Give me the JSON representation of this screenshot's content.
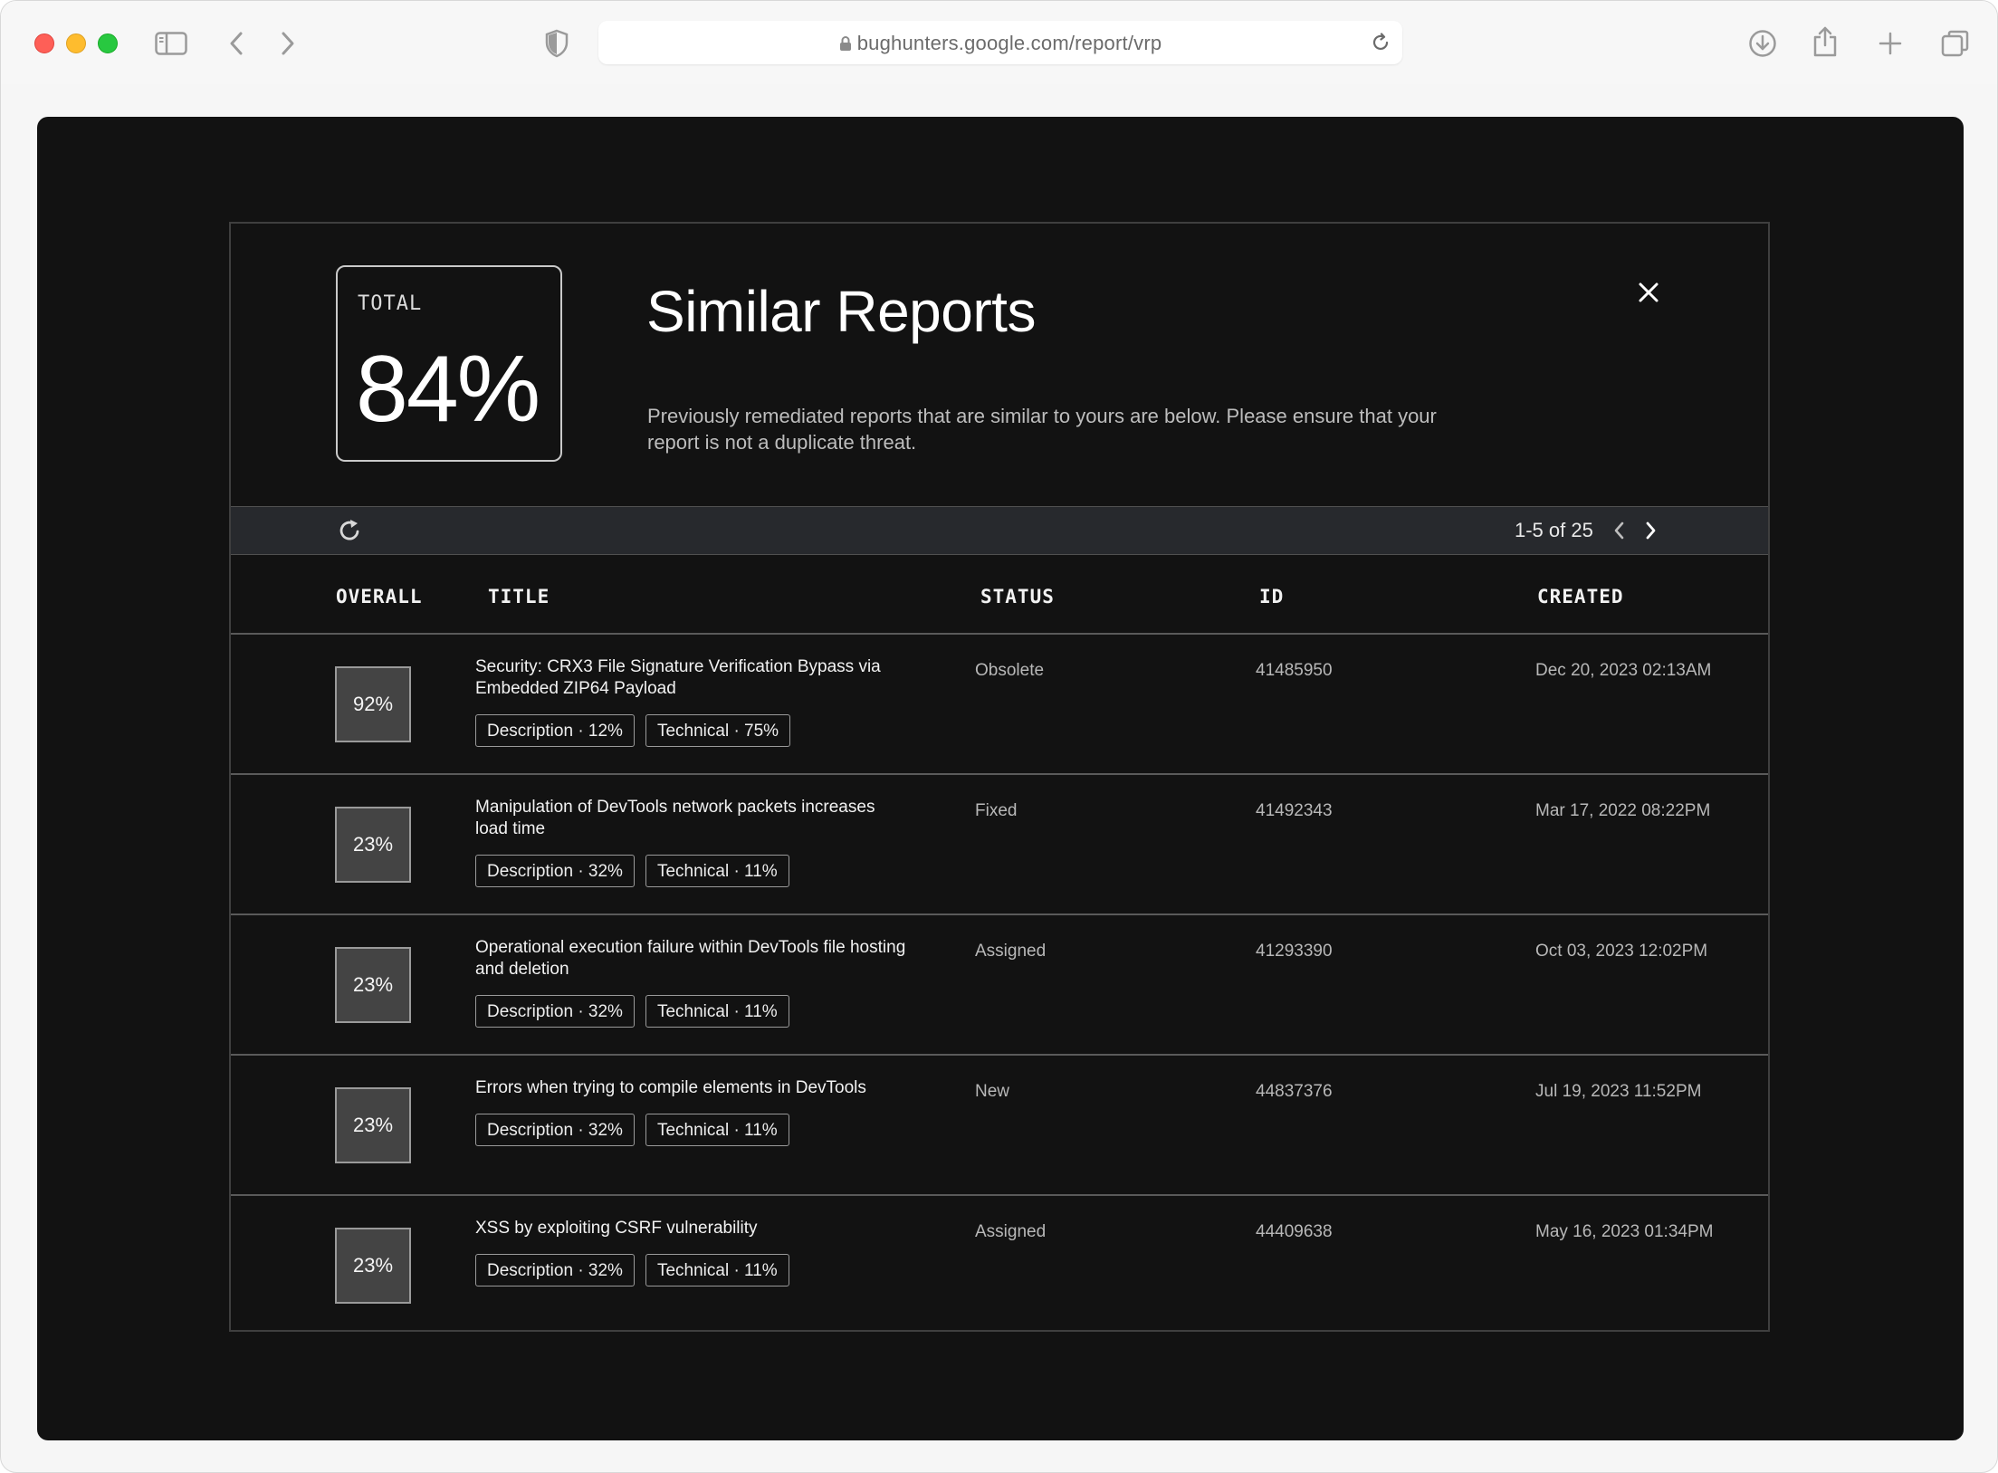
{
  "browser": {
    "url": "bughunters.google.com/report/vrp"
  },
  "summary": {
    "total_label": "TOTAL",
    "total_value": "84%"
  },
  "dialog": {
    "title": "Similar Reports",
    "description": "Previously remediated reports that are similar to yours are below. Please ensure that your report is not a duplicate threat."
  },
  "pagination": {
    "range": "1-5 of 25"
  },
  "table": {
    "headers": {
      "overall": "OVERALL",
      "title": "TITLE",
      "status": "STATUS",
      "id": "ID",
      "created": "CREATED"
    },
    "rows": [
      {
        "overall": "92%",
        "title": "Security: CRX3 File Signature Verification Bypass via Embedded ZIP64 Payload",
        "tags": [
          "Description · 12%",
          "Technical · 75%"
        ],
        "status": "Obsolete",
        "id": "41485950",
        "created": "Dec 20, 2023 02:13AM"
      },
      {
        "overall": "23%",
        "title": "Manipulation of DevTools network packets increases load time",
        "tags": [
          "Description · 32%",
          "Technical · 11%"
        ],
        "status": "Fixed",
        "id": "41492343",
        "created": "Mar 17, 2022 08:22PM"
      },
      {
        "overall": "23%",
        "title": "Operational execution failure within DevTools file hosting and deletion",
        "tags": [
          "Description · 32%",
          "Technical · 11%"
        ],
        "status": "Assigned",
        "id": "41293390",
        "created": "Oct 03, 2023 12:02PM"
      },
      {
        "overall": "23%",
        "title": "Errors when trying to compile elements in DevTools",
        "tags": [
          "Description · 32%",
          "Technical · 11%"
        ],
        "status": "New",
        "id": "44837376",
        "created": "Jul 19, 2023 11:52PM"
      },
      {
        "overall": "23%",
        "title": "XSS by exploiting CSRF vulnerability",
        "tags": [
          "Description · 32%",
          "Technical · 11%"
        ],
        "status": "Assigned",
        "id": "44409638",
        "created": "May 16, 2023 01:34PM"
      }
    ]
  },
  "icons": {
    "sidebar": "sidebar-icon",
    "back": "chevron-left-icon",
    "forward": "chevron-right-icon",
    "privacy": "shield-icon",
    "lock": "lock-icon",
    "reload": "reload-icon",
    "download": "download-icon",
    "share": "share-icon",
    "new_tab": "plus-icon",
    "tabs": "tabs-overview-icon",
    "close": "close-icon",
    "refresh": "refresh-icon",
    "prev_page": "chevron-left-icon",
    "next_page": "chevron-right-icon"
  }
}
